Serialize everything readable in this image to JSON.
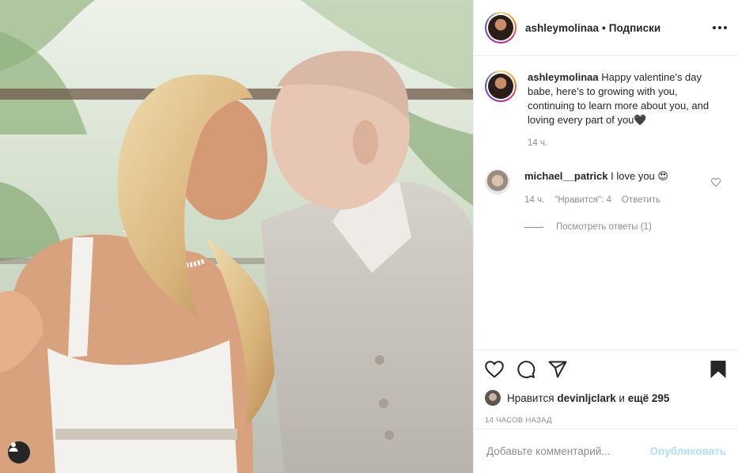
{
  "post": {
    "author": "ashleymolinaa",
    "follow_separator": "•",
    "follow_status": "Подписки",
    "caption": "Happy valentine's day babe, here's to growing with you, continuing to learn more about you, and loving every part of you🖤",
    "caption_age": "14 ч."
  },
  "comments": [
    {
      "username": "michael__patrick",
      "text": "I love you 😍",
      "age": "14 ч.",
      "likes_label": "\"Нравится\": 4",
      "reply_label": "Ответить",
      "view_replies": "Посмотреть ответы (1)"
    }
  ],
  "likes": {
    "prefix": "Нравится",
    "user": "devinljclark",
    "connector": "и",
    "others": "ещё 295"
  },
  "timestamp": "14 ЧАСОВ НАЗАД",
  "composer": {
    "placeholder": "Добавьте комментарий...",
    "publish_label": "Опубликовать"
  },
  "colors": {
    "accent_disabled": "#b2dffc",
    "muted_text": "#8e8e8e",
    "border": "#efefef"
  }
}
